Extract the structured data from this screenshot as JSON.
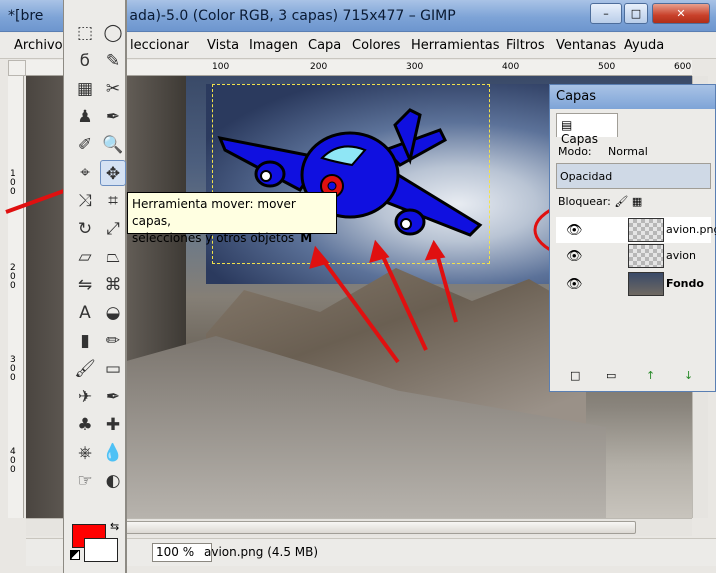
{
  "window": {
    "title": "*[bre",
    "title_rest": "ada)-5.0 (Color RGB, 3 capas) 715x477 – GIMP",
    "minimize": "–",
    "maximize": "□",
    "close": "✕"
  },
  "menu": [
    "Archivo",
    "leccionar",
    "Vista",
    "Imagen",
    "Capa",
    "Colores",
    "Herramientas",
    "Filtros",
    "Ventanas",
    "Ayuda"
  ],
  "hruler": [
    "100",
    "200",
    "300",
    "400",
    "500",
    "600"
  ],
  "vruler": [
    "100",
    "200",
    "300",
    "400"
  ],
  "toolbox": {
    "icons": [
      "rect-select-icon",
      "ellipse-select-icon",
      "free-select-icon",
      "fuzzy-select-icon",
      "select-by-color-icon",
      "scissors-icon",
      "foreground-select-icon",
      "paths-icon",
      "color-picker-icon",
      "magnify-icon",
      "measure-icon",
      "move-icon",
      "align-icon",
      "crop-icon",
      "rotate-icon",
      "scale-icon",
      "shear-icon",
      "perspective-icon",
      "flip-icon",
      "cage-icon",
      "text-icon",
      "bucket-fill-icon",
      "blend-icon",
      "pencil-icon",
      "paintbrush-icon",
      "eraser-icon",
      "airbrush-icon",
      "ink-icon",
      "clone-icon",
      "heal-icon",
      "perspective-clone-icon",
      "blur-icon",
      "smudge-icon",
      "dodge-burn-icon"
    ],
    "glyphs": [
      "⬚",
      "◯",
      "ϭ",
      "✎",
      "▦",
      "✂",
      "♟",
      "✒",
      "✐",
      "🔍",
      "⌖",
      "✥",
      "⤨",
      "⌗",
      "↻",
      "⤢",
      "▱",
      "⏢",
      "⇋",
      "⌘",
      "A",
      "◒",
      "▮",
      "✏",
      "🖌",
      "▭",
      "✈",
      "✒",
      "♣",
      "✚",
      "⎈",
      "💧",
      "☞",
      "◐"
    ],
    "fg_color": "#ff0000",
    "bg_color": "#ffffff"
  },
  "tooltip": {
    "line1": "Herramienta mover: mover capas,",
    "line2": "selecciones y otros objetos",
    "shortcut": "M"
  },
  "layers": {
    "title": "Capas",
    "tab": "Capas",
    "mode_label": "Modo:",
    "mode_value": "Normal",
    "opacity_label": "Opacidad",
    "lock_label": "Bloquear:",
    "rows": [
      {
        "name": "avion.png",
        "eye": "👁"
      },
      {
        "name": "avion",
        "eye": "👁"
      },
      {
        "name": "Fondo",
        "eye": "👁"
      }
    ],
    "buttons": [
      "□",
      "▭",
      "↑",
      "↓"
    ]
  },
  "status": {
    "zoom": "100 %",
    "text": "avion.png (4.5 MB)"
  },
  "colors": {
    "annotation_red": "#e01010",
    "plane_blue": "#1010e0"
  }
}
